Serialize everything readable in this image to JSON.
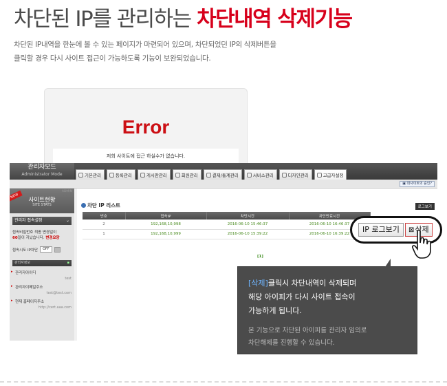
{
  "headline": {
    "normal": "차단된 IP를 관리하는 ",
    "strong": "차단내역 삭제기능"
  },
  "intro": {
    "line1": "차단된 IP내역을 한눈에 볼 수 있는 페이지가 마련되어 있으며, 차단되었던 IP의 삭제버튼을",
    "line2": "클릭할 경우 다시 사이트 접근이 가능하도록 기능이 보완되었습니다."
  },
  "error_card": {
    "title": "Error",
    "message": "저희 사이트에 접근 하실수가 없습니다."
  },
  "admin": {
    "logo_title": "관리자모드",
    "logo_sub": "Administrator Mode",
    "menu_tabs": [
      "기본관리",
      "등록관리",
      "게시판관리",
      "회원관리",
      "결제/통계관리",
      "서비스관리",
      "디자인관리",
      "고급자설정"
    ],
    "subbar_button": "▣ 대사이트의 승인?",
    "sidebar": {
      "badge": "NEW",
      "admin_label": "ADMIN",
      "title": "사이트현황",
      "subtitle": "SITE STATS",
      "select_label": "관리자 접속설정",
      "notice_line1": "접속비밀번호 최종 변경일이",
      "notice_days": "60",
      "notice_mid": "일이 지났습니다.",
      "notice_link": "변경요망",
      "ip_control_label": "접속시도 IP차단",
      "ip_control_value": "OFF",
      "info_head": "관리자정보",
      "info_items": [
        {
          "label": "관리자아이디",
          "value": "test"
        },
        {
          "label": "관리자이메일주소",
          "value": "test@test.com"
        },
        {
          "label": "현재 홈페이지주소",
          "value": "http://cert.aaa.com"
        }
      ]
    },
    "content": {
      "title": "차단 IP 리스트",
      "logview_button": "로그보기",
      "columns": [
        "번호",
        "접속IP",
        "차단시간",
        "차단만료시간"
      ],
      "rows": [
        {
          "no": "2",
          "ip": "192,168,10,998",
          "blocked": "2016-06-10 15:46:37",
          "expires": "2016-06-10 16:46:37"
        },
        {
          "no": "1",
          "ip": "192,168,10,999",
          "blocked": "2016-06-10 15:39:22",
          "expires": "2016-06-10 16:39:22"
        }
      ],
      "pager": "[1]"
    }
  },
  "callout": {
    "log_button": "IP 로그보기",
    "delete_icon": "⊠",
    "delete_button": "삭제"
  },
  "tooltip": {
    "accent": "[삭제]",
    "line1_rest": "클릭시 차단내역이 삭제되며",
    "line2": "해당 아이피가 다시 사이트 접속이",
    "line3": "가능하게 됩니다.",
    "sub1": "본 기능으로 차단된 아이피를 관리자 임의로",
    "sub2": "차단해제를 진행할 수 있습니다."
  },
  "colors": {
    "accent_red": "#d7001b",
    "tooltip_bg": "#4b4b4b",
    "tooltip_accent": "#6fb5ff",
    "ip_green": "#46891b"
  }
}
